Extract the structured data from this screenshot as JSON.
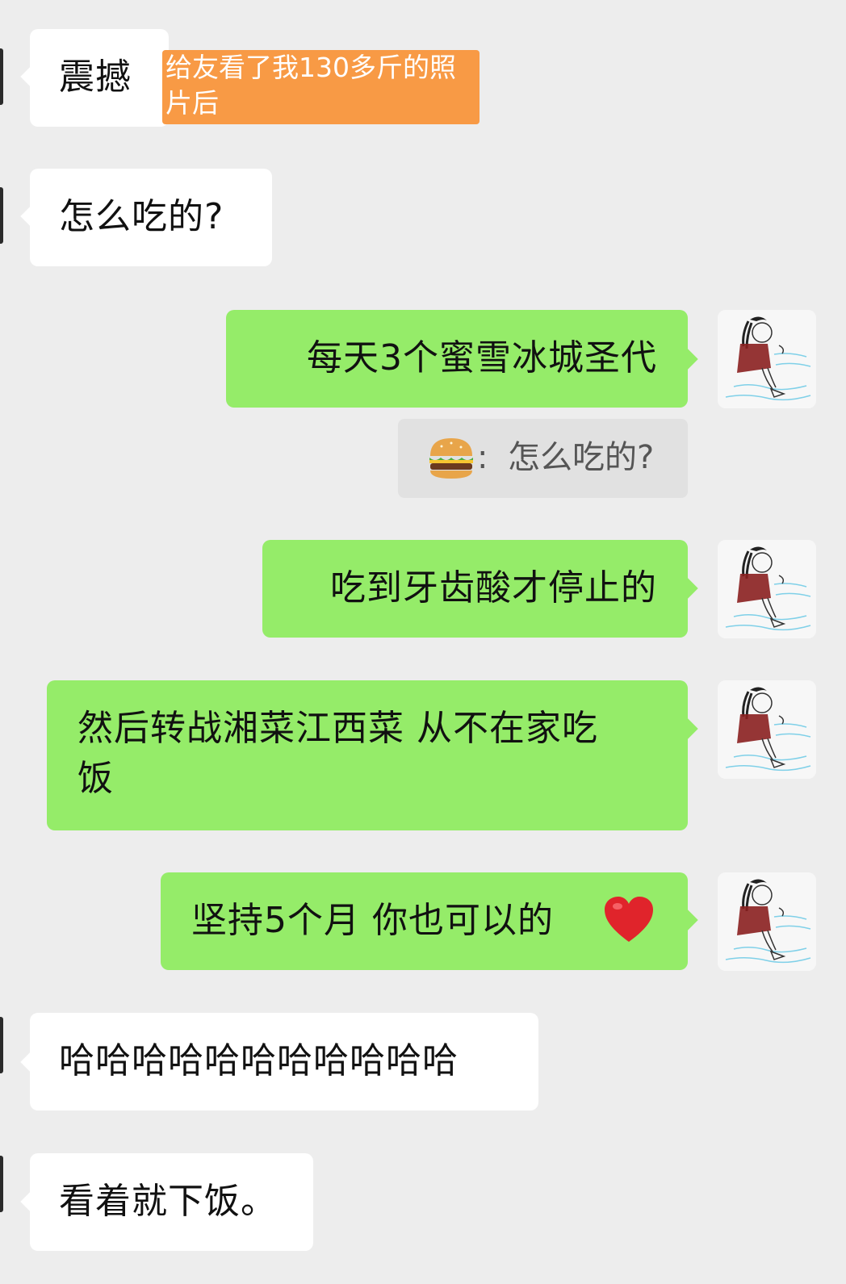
{
  "messages": [
    {
      "text": "震撼"
    },
    {
      "text": "怎么吃的?"
    },
    {
      "text": "每天3个蜜雪冰城圣代"
    },
    {
      "quote_icon": "hamburger-emoji",
      "quote_sep": ":",
      "quote_text": "怎么吃的?"
    },
    {
      "text": "吃到牙齿酸才停止的"
    },
    {
      "line1": "然后转战湘菜江西菜 从不在家吃",
      "line2": "饭"
    },
    {
      "text": "坚持5个月 你也可以的"
    },
    {
      "text": "哈哈哈哈哈哈哈哈哈哈哈"
    },
    {
      "text": "看着就下饭。"
    }
  ],
  "overlay": {
    "line1": "给友看了我130多斤的照",
    "line2": "片后"
  },
  "icons": {
    "heart": "red-heart-emoji",
    "hamburger": "hamburger-emoji",
    "avatar": "mermaid-drawing-avatar"
  },
  "colors": {
    "background": "#ededed",
    "incoming_bubble": "#ffffff",
    "outgoing_bubble": "#95ec69",
    "quote_bubble": "#e1e1e1",
    "overlay_label": "#f89a45"
  }
}
